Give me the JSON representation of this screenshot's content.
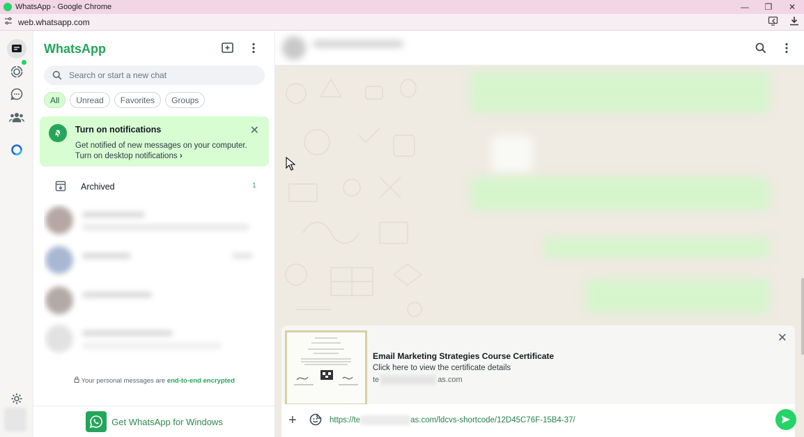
{
  "window": {
    "title": "WhatsApp - Google Chrome",
    "url": "web.whatsapp.com",
    "minimize": "—",
    "restore": "❐",
    "close": "✕"
  },
  "sidebar": {
    "brand": "WhatsApp",
    "search_placeholder": "Search or start a new chat",
    "filters": [
      "All",
      "Unread",
      "Favorites",
      "Groups"
    ],
    "notification": {
      "title": "Turn on notifications",
      "line1": "Get notified of new messages on your computer.",
      "line2": "Turn on desktop notifications",
      "chevron": "›",
      "close": "✕"
    },
    "archived": {
      "label": "Archived",
      "count": "1"
    },
    "encryption_prefix": "Your personal messages are",
    "encryption_link": "end-to-end encrypted",
    "get_app": "Get WhatsApp for Windows"
  },
  "preview": {
    "title": "Email Marketing Strategies Course Certificate",
    "description": "Click here to view the certificate details",
    "url_start": "te",
    "url_end": "as.com",
    "close": "✕"
  },
  "composer": {
    "plus": "+",
    "text_start": "https://te",
    "text_end": "as.com/ldcvs-shortcode/12D45C76F-15B4-37/"
  },
  "colors": {
    "accent": "#25d366",
    "brand_text": "#25a55a",
    "notif_bg": "#d9fdd3",
    "chat_bg": "#efeae2"
  }
}
